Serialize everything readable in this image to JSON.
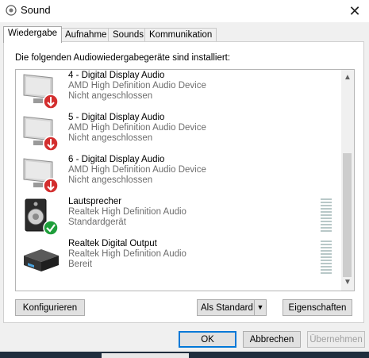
{
  "window": {
    "title": "Sound",
    "close_label": "✕"
  },
  "tabs": [
    {
      "label": "Wiedergabe",
      "active": true
    },
    {
      "label": "Aufnahme"
    },
    {
      "label": "Sounds"
    },
    {
      "label": "Kommunikation"
    }
  ],
  "intro_text": "Die folgenden Audiowiedergabegeräte sind installiert:",
  "devices": [
    {
      "name": "4 - Digital Display Audio",
      "description": "AMD High Definition Audio Device",
      "status": "Nicht angeschlossen",
      "icon": "monitor-disconnected-icon"
    },
    {
      "name": "5 - Digital Display Audio",
      "description": "AMD High Definition Audio Device",
      "status": "Nicht angeschlossen",
      "icon": "monitor-disconnected-icon"
    },
    {
      "name": "6 - Digital Display Audio",
      "description": "AMD High Definition Audio Device",
      "status": "Nicht angeschlossen",
      "icon": "monitor-disconnected-icon"
    },
    {
      "name": "Lautsprecher",
      "description": "Realtek High Definition Audio",
      "status": "Standardgerät",
      "icon": "speaker-default-icon"
    },
    {
      "name": "Realtek Digital Output",
      "description": "Realtek High Definition Audio",
      "status": "Bereit",
      "icon": "digital-output-icon"
    }
  ],
  "buttons": {
    "configure": "Konfigurieren",
    "set_default": "Als Standard",
    "properties": "Eigenschaften",
    "ok": "OK",
    "cancel": "Abbrechen",
    "apply": "Übernehmen"
  },
  "colors": {
    "accent": "#0078d7",
    "disconnected_badge": "#d32f2f",
    "default_badge": "#1e9e3a"
  }
}
